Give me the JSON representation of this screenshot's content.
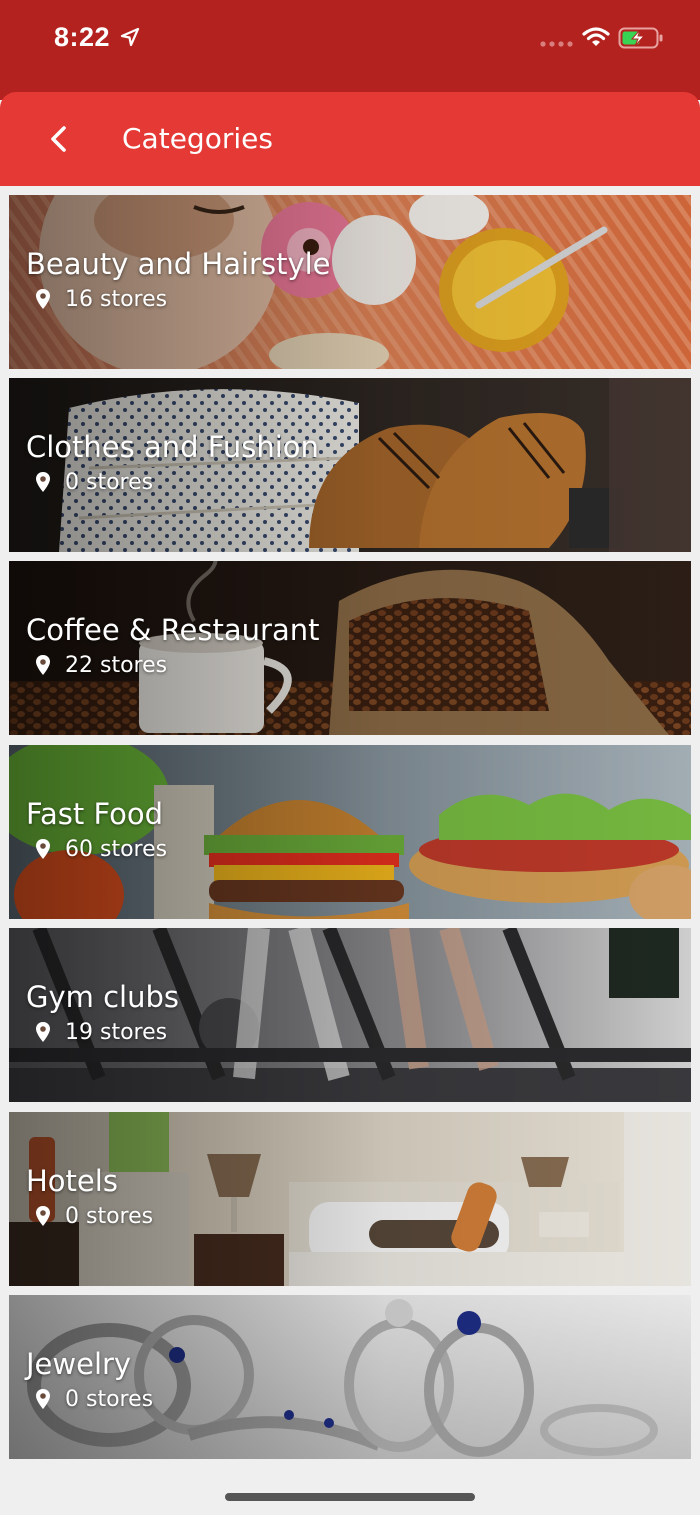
{
  "status_bar": {
    "time": "8:22",
    "icons": [
      "location-arrow-icon",
      "signal-icon",
      "wifi-icon",
      "battery-charging-icon"
    ]
  },
  "header": {
    "back_icon": "chevron-left-icon",
    "title": "Categories"
  },
  "colors": {
    "status_bar": "#b3221f",
    "app_bar": "#e53935",
    "background": "#efefef",
    "text": "#ffffff"
  },
  "categories": [
    {
      "name": "Beauty and Hairstyle",
      "stores": "16 stores",
      "icon": "map-pin-icon"
    },
    {
      "name": "Clothes and Fushion",
      "stores": "0 stores",
      "icon": "map-pin-icon"
    },
    {
      "name": "Coffee & Restaurant",
      "stores": "22 stores",
      "icon": "map-pin-icon"
    },
    {
      "name": "Fast Food",
      "stores": "60 stores",
      "icon": "map-pin-icon"
    },
    {
      "name": "Gym clubs",
      "stores": "19 stores",
      "icon": "map-pin-icon"
    },
    {
      "name": "Hotels",
      "stores": "0 stores",
      "icon": "map-pin-icon"
    },
    {
      "name": "Jewelry",
      "stores": "0 stores",
      "icon": "map-pin-icon"
    }
  ]
}
